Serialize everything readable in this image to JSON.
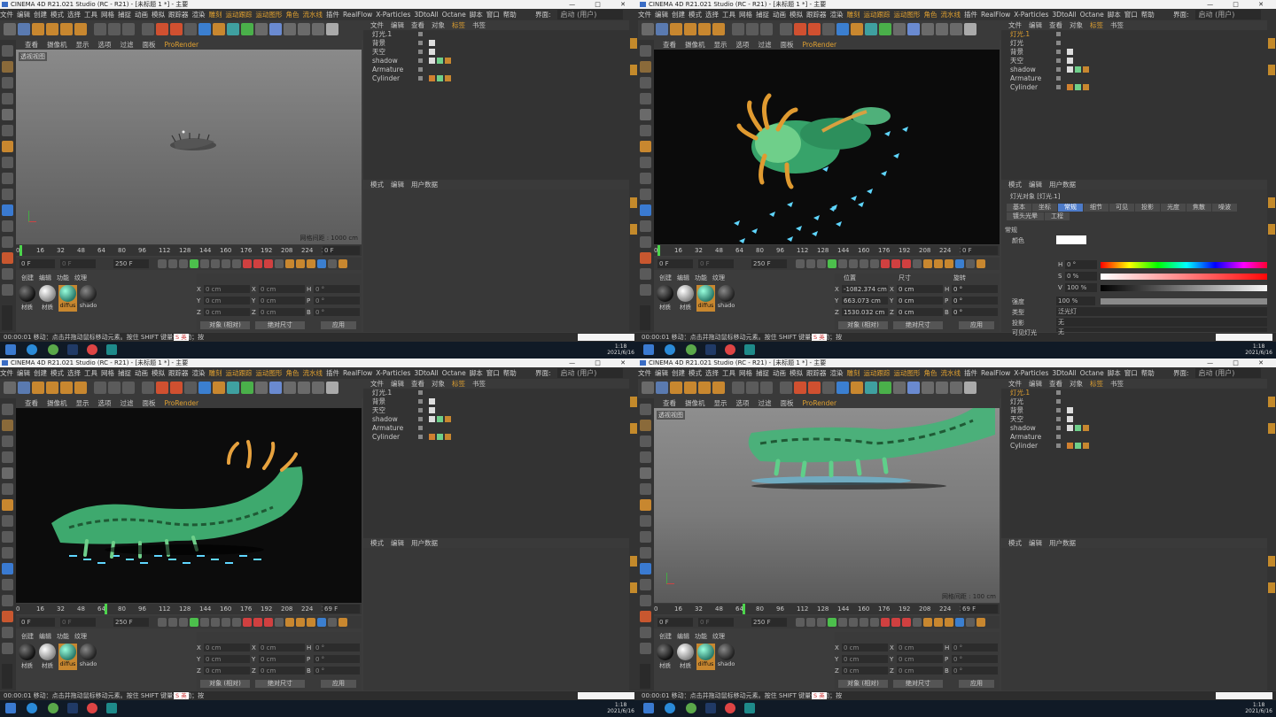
{
  "window": {
    "title": "CINEMA 4D R21.021 Studio (RC - R21) - [未标题 1 *] - 主要",
    "controls": "— □ ✕"
  },
  "menus": [
    "文件",
    "编辑",
    "创建",
    "模式",
    "选择",
    "工具",
    "网格",
    "捕捉",
    "动画",
    "模拟",
    "跟踪器",
    "渲染",
    "雕刻",
    "运动跟踪",
    "运动图形",
    "角色",
    "流水线",
    "插件",
    "RealFlow",
    "X-Particles",
    "3DtoAll",
    "Octane",
    "脚本",
    "窗口",
    "帮助"
  ],
  "interface_label": "界面:",
  "interface_value": "启动 (用户)",
  "viewport_menu": [
    "查看",
    "摄像机",
    "显示",
    "选项",
    "过滤",
    "面板",
    "ProRender"
  ],
  "viewport_label": "透视视图",
  "grid_text": "网格间距 : 1000 cm",
  "grid_text_b": "网格间距 : 100 cm",
  "ruler": [
    "0",
    "16",
    "32",
    "48",
    "64",
    "80",
    "96",
    "112",
    "128",
    "144",
    "160",
    "176",
    "192",
    "208",
    "224",
    "240"
  ],
  "frame_start": "0 F",
  "frame_cur": "0 F",
  "frame_end": "250 F",
  "frame_end2": "250 F",
  "frame_display": "0 F",
  "frame_display_b": "69 F",
  "frame_display_c": "69 F",
  "obj_menu": [
    "文件",
    "编辑",
    "查看",
    "对象",
    "标签",
    "书签"
  ],
  "objects": [
    "灯光.1",
    "背景",
    "天空",
    "shadow",
    "Armature",
    "Cylinder"
  ],
  "objects_b": [
    "灯光.1",
    "灯光",
    "背景",
    "天空",
    "shadow",
    "Armature",
    "Cylinder"
  ],
  "attr_menu": [
    "模式",
    "编辑",
    "用户数据"
  ],
  "mat_menu": [
    "创建",
    "编辑",
    "功能",
    "纹理"
  ],
  "materials": [
    "材质",
    "材质",
    "diffus",
    "shado"
  ],
  "coords": {
    "x": "0 cm",
    "y": "0 cm",
    "z": "0 cm",
    "h": "0 °",
    "p": "0 °",
    "b": "0 °"
  },
  "coords_b": {
    "px": "-1082.374 cm",
    "py": "663.073 cm",
    "pz": "1530.032 cm",
    "sx": "0 cm",
    "sy": "0 cm",
    "sz": "0 cm",
    "h": "0 °",
    "p": "0 °",
    "b": "0 °"
  },
  "coord_headers": [
    "位置",
    "尺寸",
    "旋转"
  ],
  "coord_mode_a": "对象 (相对)",
  "coord_mode_b": "绝对尺寸",
  "apply": "应用",
  "status_time": "00:00:01",
  "status_msg": "移动：点击并拖动鼠标移动元素。按住 SHIFT 键量化移动；按",
  "ime_label": "S 英",
  "light_title": "灯光对象 [灯光.1]",
  "light_tabs": [
    "基本",
    "坐标",
    "常规",
    "细节",
    "可见",
    "投影",
    "光度",
    "焦散",
    "噪波",
    "镀头光晕",
    "工程"
  ],
  "light_section": "常规",
  "color_label": "颜色",
  "hsv": {
    "h": "0 °",
    "s": "0 %",
    "v": "100 %"
  },
  "intensity_label": "强度",
  "intensity": "100 %",
  "type_label": "类型",
  "type_value": "泛光灯",
  "shadow_label": "投影",
  "shadow_value": "无",
  "visible_label": "可见灯光",
  "visible_value": "无",
  "tray_time": "1:18",
  "tray_date": "2021/6/16",
  "colors": {
    "accent": "#e0a030",
    "blue": "#4d7bc9",
    "taskbar": "#101a26"
  }
}
